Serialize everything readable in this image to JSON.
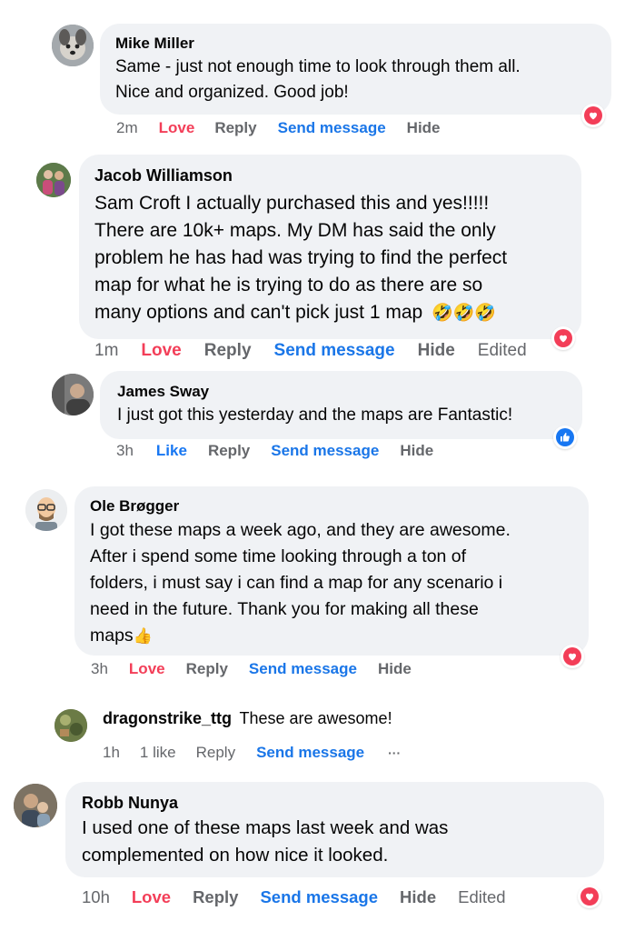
{
  "colors": {
    "bubble": "#f0f2f5",
    "love": "#f33e58",
    "like": "#1877f2",
    "link": "#1a76e8",
    "muted": "#65676b"
  },
  "comments": [
    {
      "name": "Mike Miller",
      "text": "Same - just not enough time to look through them all.\nNice and organized. Good job!",
      "time": "2m",
      "love": "Love",
      "reply": "Reply",
      "send": "Send message",
      "hide": "Hide",
      "reaction": "heart-icon"
    },
    {
      "name": "Jacob Williamson",
      "text": "Sam Croft I actually purchased this and yes!!!!!\nThere are 10k+ maps. My DM has said the only\nproblem he has had was trying to find the perfect\nmap for what he is trying to do as there are so\nmany options and can't pick just 1 map",
      "emoji": "🤣🤣🤣",
      "time": "1m",
      "love": "Love",
      "reply": "Reply",
      "send": "Send message",
      "hide": "Hide",
      "edited": "Edited",
      "reaction": "heart-icon"
    },
    {
      "name": "James Sway",
      "text": "I just got this yesterday and the maps are Fantastic!",
      "time": "3h",
      "like": "Like",
      "reply": "Reply",
      "send": "Send message",
      "hide": "Hide",
      "reaction": "thumbs-up-icon"
    },
    {
      "name": "Ole Brøgger",
      "text": "I got these maps a week ago, and they are awesome.\nAfter i spend some time looking through a ton of\nfolders, i must say i can find a map for any scenario i\nneed in the future. Thank you for making all these\nmaps",
      "emoji": "👍",
      "time": "3h",
      "love": "Love",
      "reply": "Reply",
      "send": "Send message",
      "hide": "Hide",
      "reaction": "heart-icon"
    },
    {
      "name": "dragonstrike_ttg",
      "text": "These are awesome!",
      "time": "1h",
      "likes": "1 like",
      "reply": "Reply",
      "send": "Send message",
      "more": "···"
    },
    {
      "name": "Robb Nunya",
      "text": "I used one of these maps last week and was\ncomplemented on how nice it looked.",
      "time": "10h",
      "love": "Love",
      "reply": "Reply",
      "send": "Send message",
      "hide": "Hide",
      "edited": "Edited",
      "reaction": "heart-icon"
    }
  ]
}
